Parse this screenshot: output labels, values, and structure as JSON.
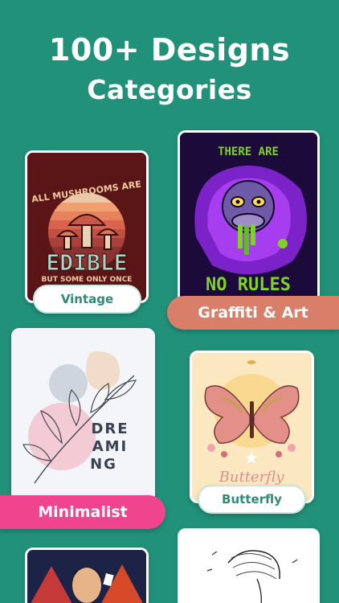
{
  "headline": {
    "line1": "100+ Designs",
    "line2": "Categories"
  },
  "cards": {
    "vintage": {
      "label": "Vintage",
      "art": {
        "top_text": "ALL MUSHROOMS ARE",
        "main_text": "EDIBLE",
        "sub_text": "BUT SOME ONLY ONCE"
      }
    },
    "graffiti": {
      "label": "Graffiti & Art",
      "art": {
        "top_text": "THERE ARE",
        "bottom_text": "NO RULES"
      }
    },
    "minimalist": {
      "label": "Minimalist",
      "art": {
        "line1": "DRE",
        "line2": "AMI",
        "line3": "NG"
      }
    },
    "butterfly": {
      "label": "Butterfly",
      "art": {
        "script_text": "Butterfly"
      }
    }
  },
  "colors": {
    "background": "#21917a",
    "coral_pill": "#d97e68",
    "pink_pill": "#f0458e"
  }
}
